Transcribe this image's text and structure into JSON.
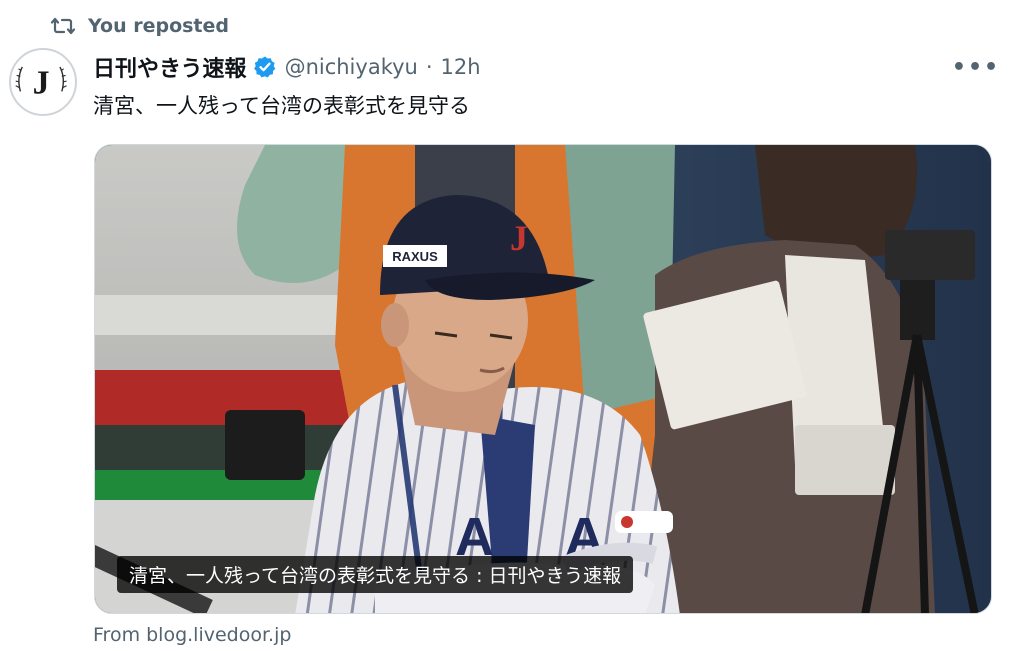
{
  "repost": {
    "icon": "repost-icon",
    "label": "You reposted"
  },
  "author": {
    "avatar_letter": "J",
    "display_name": "日刊やきう速報",
    "verified_icon": "verified-badge-icon",
    "handle": "@nichiyakyu",
    "separator": "·",
    "time": "12h"
  },
  "menu": {
    "icon": "more-options-icon",
    "label": "•••"
  },
  "tweet": {
    "text": "清宮、一人残って台湾の表彰式を見守る"
  },
  "card": {
    "image_description": "Japanese baseball player in navy J cap and pinstripe jersey with lanyard, arms crossed",
    "cap_logo_text": "RAXUS",
    "caption": "清宮、一人残って台湾の表彰式を見守る : 日刊やきう速報",
    "source": "From blog.livedoor.jp"
  },
  "colors": {
    "text_primary": "#0f1419",
    "text_secondary": "#536471",
    "verified_blue": "#1d9bf0",
    "border": "#cfd9de"
  }
}
